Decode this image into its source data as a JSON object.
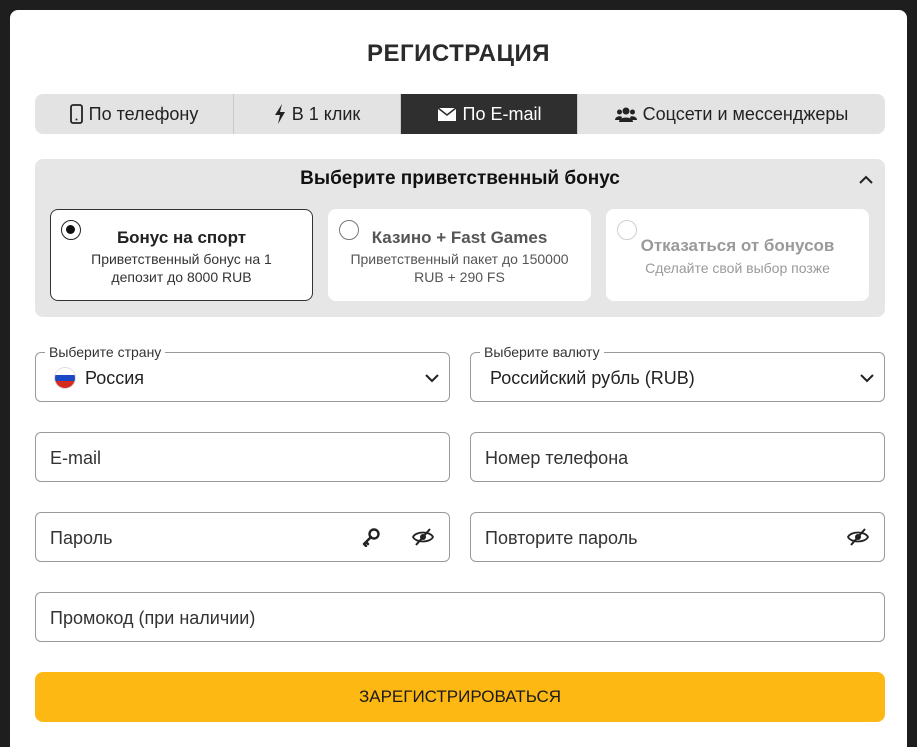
{
  "modal": {
    "title": "РЕГИСТРАЦИЯ"
  },
  "tabs": [
    {
      "label": "По телефону",
      "icon": "smartphone-icon",
      "active": false
    },
    {
      "label": "В 1 клик",
      "icon": "lightning-icon",
      "active": false
    },
    {
      "label": "По E-mail",
      "icon": "envelope-icon",
      "active": true
    },
    {
      "label": "Соцсети и мессенджеры",
      "icon": "users-icon",
      "active": false
    }
  ],
  "bonus": {
    "heading": "Выберите приветственный бонус",
    "collapse_icon": "chevron-up-icon",
    "options": [
      {
        "title": "Бонус на спорт",
        "desc": "Приветственный бонус на 1 депозит до 8000 RUB",
        "selected": true
      },
      {
        "title": "Казино + Fast Games",
        "desc": "Приветственный пакет до 150000 RUB + 290 FS",
        "selected": false
      },
      {
        "title": "Отказаться от бонусов",
        "desc": "Сделайте свой выбор позже",
        "selected": false
      }
    ]
  },
  "form": {
    "country": {
      "label": "Выберите страну",
      "value": "Россия",
      "flag": "russia-flag-icon"
    },
    "currency": {
      "label": "Выберите валюту",
      "value": "Российский рубль (RUB)"
    },
    "email": {
      "placeholder": "E-mail"
    },
    "phone": {
      "placeholder": "Номер телефона"
    },
    "password": {
      "placeholder": "Пароль"
    },
    "password_repeat": {
      "placeholder": "Повторите пароль"
    },
    "promo": {
      "placeholder": "Промокод (при наличии)"
    }
  },
  "submit": {
    "label": "ЗАРЕГИСТРИРОВАТЬСЯ"
  },
  "colors": {
    "accent": "#fdb813",
    "active_tab": "#2f2f2f",
    "panel": "#e6e6e6",
    "backdrop": "#1e1e1e"
  }
}
